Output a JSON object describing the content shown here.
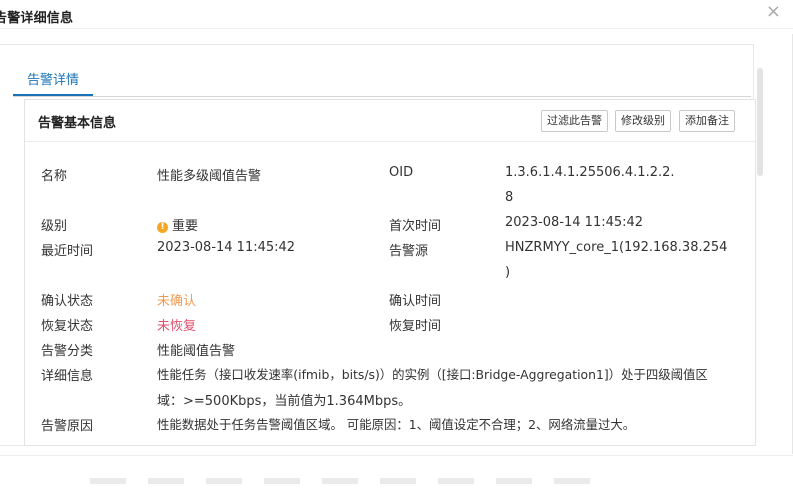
{
  "dialog": {
    "title": "告警详细信息",
    "close_glyph": "×"
  },
  "tabs": [
    {
      "label": "告警详情",
      "active": true
    }
  ],
  "section": {
    "title": "告警基本信息",
    "buttons": {
      "filter": "过滤此告警",
      "change_level": "修改级别",
      "add_note": "添加备注"
    }
  },
  "fields": {
    "name_label": "名称",
    "name_value": "性能多级阈值告警",
    "oid_label": "OID",
    "oid_line1": "1.3.6.1.4.1.25506.4.1.2.2.",
    "oid_line2": "8",
    "level_label": "级别",
    "level_icon": "!",
    "level_value": "重要",
    "first_time_label": "首次时间",
    "first_time_value": "2023-08-14 11:45:42",
    "last_time_label": "最近时间",
    "last_time_value": "2023-08-14 11:45:42",
    "source_label": "告警源",
    "source_line1": "HNZRMYY_core_1(192.168.38.254",
    "source_line2": ")",
    "confirm_status_label": "确认状态",
    "confirm_status_value": "未确认",
    "confirm_time_label": "确认时间",
    "recover_status_label": "恢复状态",
    "recover_status_value": "未恢复",
    "recover_time_label": "恢复时间",
    "category_label": "告警分类",
    "category_value": "性能阈值告警",
    "detail_label": "详细信息",
    "detail_line1": "性能任务（接口收发速率(ifmib，bits/s)）的实例（[接口:Bridge-Aggregation1]）处于四级阈值区",
    "detail_line2": "域：>=500Kbps，当前值为1.364Mbps。",
    "reason_label": "告警原因",
    "reason_value": "性能数据处于任务告警阈值区域。 可能原因：1、阈值设定不合理；2、网络流量过大。"
  },
  "colors": {
    "accent": "#1a73b8",
    "unconfirmed": "#f09b54",
    "unrecovered": "#e0506e",
    "warning_dot": "#f5a623"
  },
  "icons": {
    "close": "close-icon",
    "level": "warning-icon"
  }
}
